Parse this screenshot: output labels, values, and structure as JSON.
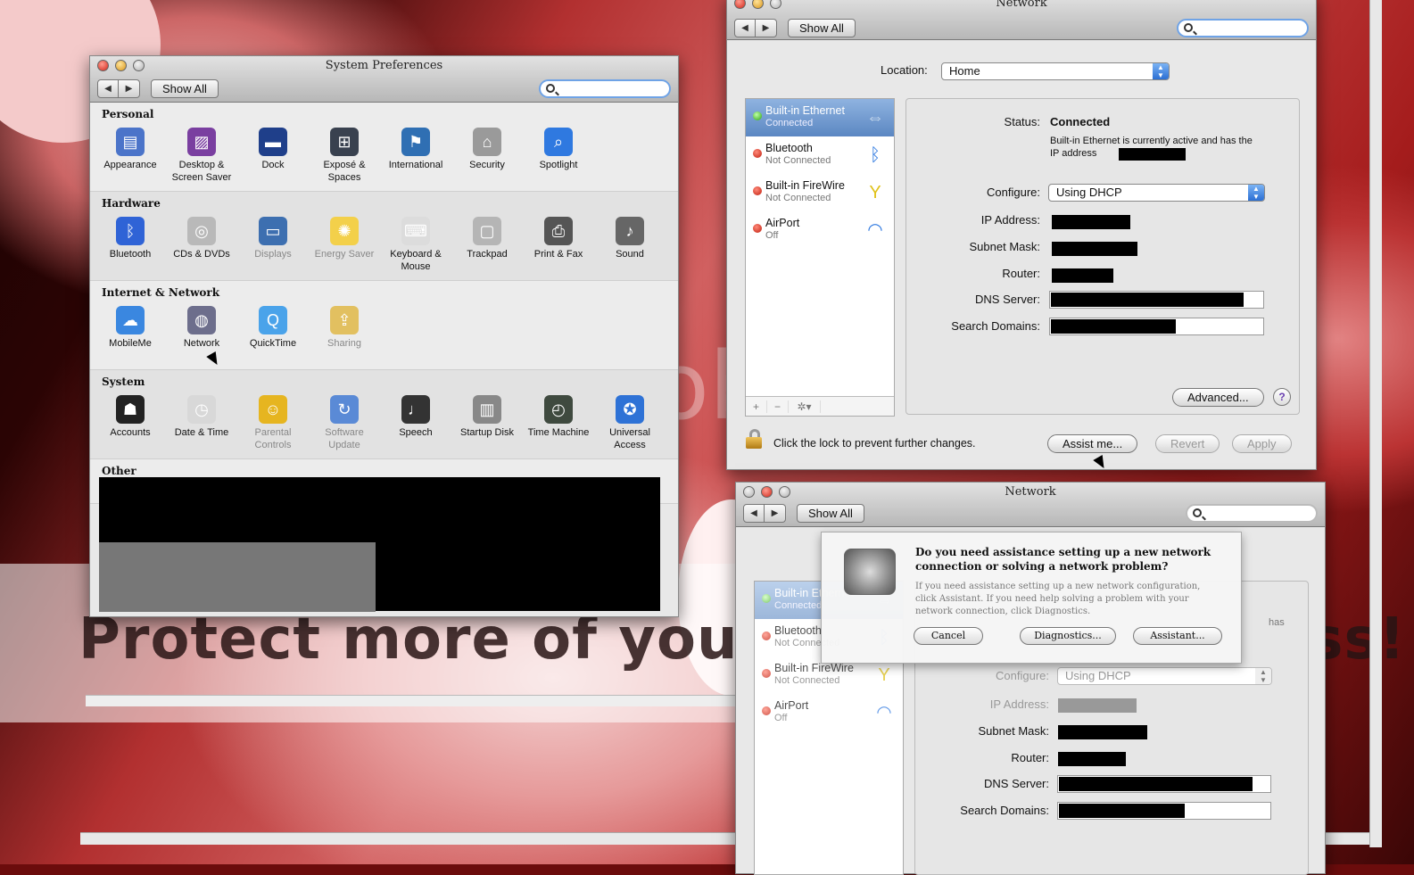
{
  "wallpaper": {
    "banner_text": "Protect more of your memories for less!",
    "watermark_text": "photobucket"
  },
  "syspref": {
    "title": "System Preferences",
    "show_all": "Show All",
    "search_value": "",
    "sections": [
      {
        "title": "Personal",
        "panes": [
          {
            "label": "Appearance",
            "icon": "appearance-icon",
            "color": "#4b74c9"
          },
          {
            "label": "Desktop & Screen Saver",
            "icon": "desktop-icon",
            "color": "#7a3fa0"
          },
          {
            "label": "Dock",
            "icon": "dock-icon",
            "color": "#1f3f8a"
          },
          {
            "label": "Exposé & Spaces",
            "icon": "expose-icon",
            "color": "#39414f"
          },
          {
            "label": "International",
            "icon": "international-icon",
            "color": "#2f6fb3"
          },
          {
            "label": "Security",
            "icon": "security-icon",
            "color": "#9a9a9a"
          },
          {
            "label": "Spotlight",
            "icon": "spotlight-icon",
            "color": "#2f79e0"
          }
        ]
      },
      {
        "title": "Hardware",
        "panes": [
          {
            "label": "Bluetooth",
            "icon": "bluetooth-icon",
            "color": "#2f63d6"
          },
          {
            "label": "CDs & DVDs",
            "icon": "cd-icon",
            "color": "#b9b9b9"
          },
          {
            "label": "Displays",
            "icon": "displays-icon",
            "color": "#3d6fb0",
            "dim": true
          },
          {
            "label": "Energy Saver",
            "icon": "energy-icon",
            "color": "#f3d04a",
            "dim": true
          },
          {
            "label": "Keyboard & Mouse",
            "icon": "keyboard-icon",
            "color": "#dcdcdc"
          },
          {
            "label": "Trackpad",
            "icon": "trackpad-icon",
            "color": "#b5b5b5"
          },
          {
            "label": "Print & Fax",
            "icon": "printer-icon",
            "color": "#555555"
          },
          {
            "label": "Sound",
            "icon": "sound-icon",
            "color": "#666666"
          }
        ]
      },
      {
        "title": "Internet & Network",
        "panes": [
          {
            "label": "MobileMe",
            "icon": "mobileme-icon",
            "color": "#3a87e0"
          },
          {
            "label": "Network",
            "icon": "network-icon",
            "color": "#6d6e8c"
          },
          {
            "label": "QuickTime",
            "icon": "quicktime-icon",
            "color": "#4aa3ea"
          },
          {
            "label": "Sharing",
            "icon": "sharing-icon",
            "color": "#e2c060",
            "dim": true
          }
        ]
      },
      {
        "title": "System",
        "panes": [
          {
            "label": "Accounts",
            "icon": "accounts-icon",
            "color": "#222222"
          },
          {
            "label": "Date & Time",
            "icon": "clock-icon",
            "color": "#d8d8d8"
          },
          {
            "label": "Parental Controls",
            "icon": "parental-icon",
            "color": "#e6b520",
            "dim": true
          },
          {
            "label": "Software Update",
            "icon": "update-icon",
            "color": "#5a8ad6",
            "dim": true
          },
          {
            "label": "Speech",
            "icon": "microphone-icon",
            "color": "#333333"
          },
          {
            "label": "Startup Disk",
            "icon": "disk-icon",
            "color": "#888888"
          },
          {
            "label": "Time Machine",
            "icon": "timemachine-icon",
            "color": "#3f4a3f"
          },
          {
            "label": "Universal Access",
            "icon": "accessibility-icon",
            "color": "#2e72d6"
          }
        ]
      },
      {
        "title": "Other",
        "panes": []
      }
    ]
  },
  "network": {
    "title": "Network",
    "show_all": "Show All",
    "location_label": "Location:",
    "location_value": "Home",
    "services": [
      {
        "name": "Built-in Ethernet",
        "status": "Connected",
        "state": "green",
        "icon": "ethernet-icon"
      },
      {
        "name": "Bluetooth",
        "status": "Not Connected",
        "state": "red",
        "icon": "bluetooth-icon"
      },
      {
        "name": "Built-in FireWire",
        "status": "Not Connected",
        "state": "red",
        "icon": "firewire-icon"
      },
      {
        "name": "AirPort",
        "status": "Off",
        "state": "red",
        "icon": "wifi-icon"
      }
    ],
    "status_label": "Status:",
    "status_value": "Connected",
    "status_desc": "Built-in Ethernet is currently active and has the IP address",
    "configure_label": "Configure:",
    "configure_value": "Using DHCP",
    "ip_label": "IP Address:",
    "subnet_label": "Subnet Mask:",
    "router_label": "Router:",
    "dns_label": "DNS Server:",
    "search_domains_label": "Search Domains:",
    "advanced": "Advanced...",
    "help": "?",
    "lock_text": "Click the lock to prevent further changes.",
    "assist": "Assist me...",
    "revert": "Revert",
    "apply": "Apply"
  },
  "sheet": {
    "heading": "Do you need assistance setting up a new network connection or solving a network problem?",
    "body": "If you need assistance setting up a new network configuration, click Assistant. If you need help solving a problem with your network connection, click Diagnostics.",
    "cancel": "Cancel",
    "diagnostics": "Diagnostics...",
    "assistant": "Assistant...",
    "partial_has": "has"
  }
}
